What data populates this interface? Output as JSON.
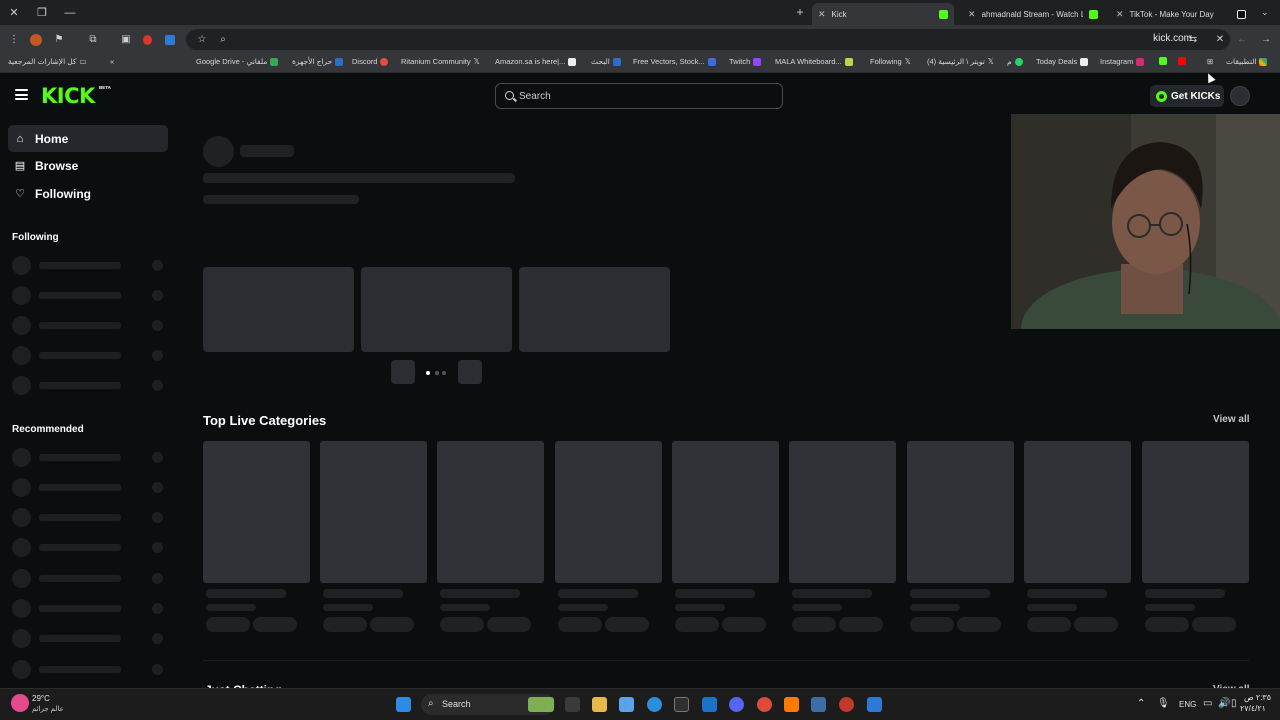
{
  "browser": {
    "tabs": [
      {
        "title": "Kick",
        "active": true,
        "favicon_color": "#53fc18"
      },
      {
        "title": "ahmadnald Stream - Watch Live",
        "active": false,
        "favicon_color": "#53fc18"
      },
      {
        "title": "TikTok - Make Your Day",
        "active": false,
        "favicon_color": "#ffffff"
      }
    ],
    "url": "kick.com",
    "bookmarks": [
      "كل الإشارات المرجعية",
      "Google Drive - ملفاتي",
      "حراج الأجهزة",
      "Discord",
      "Ritanium Community",
      "Amazon.sa is here|...",
      "البحث",
      "Free Vectors, Stock...",
      "Twitch",
      "MALA Whiteboard...",
      "Following",
      "(4) تويتر \\ الرئيسية",
      "م",
      "Today Deals",
      "Instagram",
      "التطبيقات"
    ]
  },
  "kick": {
    "logo": "KICK",
    "beta": "BETA",
    "search_placeholder": "Search",
    "get_kicks": "Get KICKs",
    "accent_color": "#53fc18",
    "nav": [
      {
        "label": "Home",
        "icon": "home-icon",
        "active": true
      },
      {
        "label": "Browse",
        "icon": "browse-icon",
        "active": false
      },
      {
        "label": "Following",
        "icon": "heart-icon",
        "active": false
      }
    ],
    "sidebar_following_title": "Following",
    "sidebar_recommended_title": "Recommended",
    "top_live_categories": "Top Live Categories",
    "view_all": "View all",
    "just_chatting": "Just Chatting"
  },
  "taskbar": {
    "weather_temp": "29°C",
    "weather_desc": "عالم جرائم",
    "search_label": "Search",
    "language": "ENG",
    "time": "٢:٣٥ ص",
    "date": "٢٧/٤/٢١"
  }
}
